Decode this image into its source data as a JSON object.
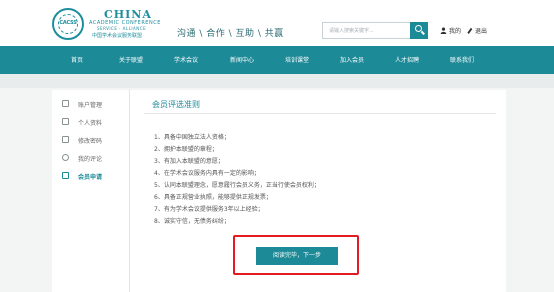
{
  "logo": {
    "emblem_text": "CACSS",
    "title": "CHINA",
    "subtitle": "ACADEMIC CONFERENCE",
    "tagline": "SERVICE · ALLIANCE",
    "cn_name": "中国学术会议服务联盟"
  },
  "header": {
    "slogan": "沟通 \\ 合作 \\ 互助 \\ 共赢",
    "search_placeholder": "请输入搜索关键字...",
    "my_label": "我的",
    "logout_label": "退出"
  },
  "nav": {
    "items": [
      "首页",
      "关于联盟",
      "学术会议",
      "新闻中心",
      "培训课堂",
      "加入会员",
      "人才招聘",
      "联系我们"
    ]
  },
  "sidebar": {
    "items": [
      {
        "label": "账户管理",
        "icon": "account-icon"
      },
      {
        "label": "个人资料",
        "icon": "profile-icon"
      },
      {
        "label": "修改密码",
        "icon": "lock-icon"
      },
      {
        "label": "我的评论",
        "icon": "comment-icon"
      },
      {
        "label": "会员申请",
        "icon": "member-icon",
        "active": true
      }
    ]
  },
  "panel": {
    "title": "会员评选准则",
    "rules": [
      "1、具备中国独立法人资格；",
      "2、拥护本联盟的章程；",
      "3、有加入本联盟的意愿；",
      "4、在学术会议服务内具有一定的影响；",
      "5、认同本联盟理念，愿意履行会员义务，正当行使会员权利；",
      "6、具备正规营业执照，能够提供正规发票；",
      "7、有为学术会议提供服务3年以上经验；",
      "8、诚实守信，无债务纠纷；"
    ],
    "next_label": "阅读完毕，下一步"
  },
  "colors": {
    "brand_teal": "#1d8a98",
    "highlight_red": "#e31b23"
  }
}
